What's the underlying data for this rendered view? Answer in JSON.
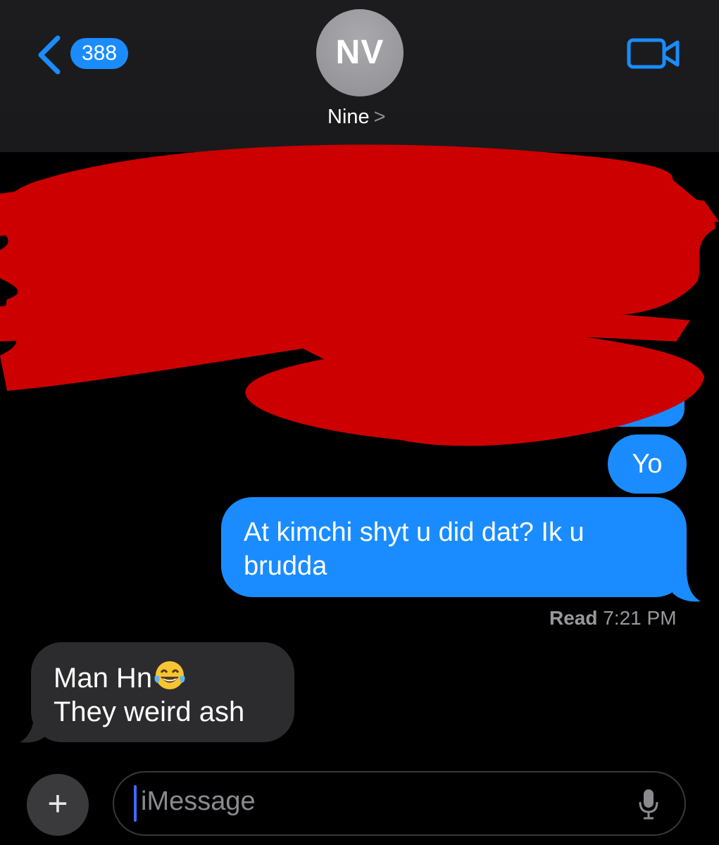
{
  "header": {
    "unread_count": "388",
    "avatar_initials": "NV",
    "contact_name": "Nine",
    "chevron": ">"
  },
  "messages": {
    "outgoing_1": "Yo",
    "outgoing_2_line1": "At kimchi shyt u did dat? Ik u",
    "outgoing_2_line2": "brudda",
    "read_label": "Read",
    "read_time": "7:21 PM",
    "incoming_line1": "Man Hn",
    "incoming_line2": "They weird ash"
  },
  "composer": {
    "plus_label": "+",
    "placeholder": "iMessage"
  },
  "colors": {
    "accent": "#1a8cff",
    "incoming_bubble": "#2c2c2e",
    "redaction": "#cc0000"
  },
  "icons": [
    "back-chevron-icon",
    "video-call-icon",
    "laughing-tears-emoji-icon",
    "microphone-icon"
  ]
}
